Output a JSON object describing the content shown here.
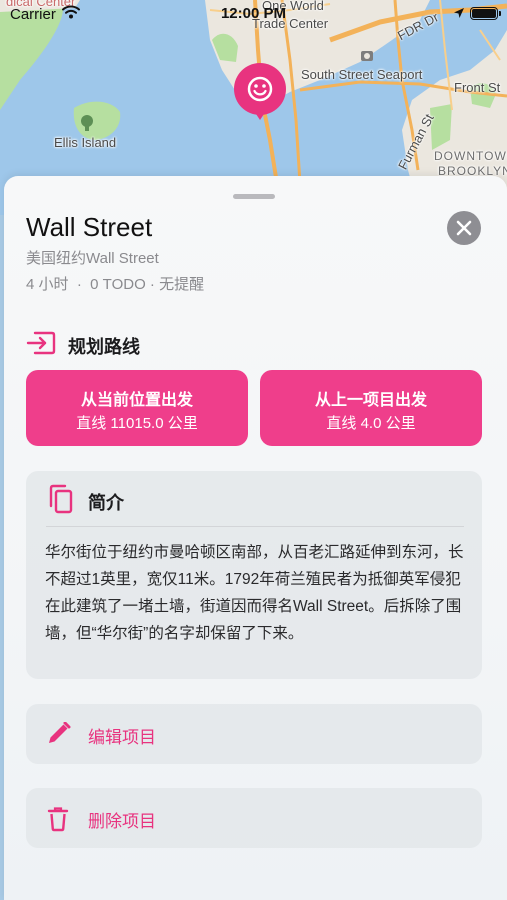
{
  "status_bar": {
    "carrier": "Carrier",
    "time": "12:00 PM"
  },
  "map": {
    "labels": {
      "medical_center": "dical Center",
      "one_world": "One World",
      "trade_center": "Trade Center",
      "fdr_dr": "FDR Dr",
      "south_street_seaport": "South Street Seaport",
      "front_st": "Front St",
      "ellis_island": "Ellis Island",
      "furman_st": "Furman St",
      "downtown": "DOWNTOWN",
      "brooklyn": "BROOKLYN"
    },
    "colors": {
      "water": "#9ec7ea",
      "land": "#ebe7df",
      "park": "#b6dfa0",
      "road": "#f3b259"
    }
  },
  "pin": {
    "icon": "smiley-face-icon",
    "color": "#e8337f"
  },
  "place": {
    "title": "Wall Street",
    "subtitle": "美国纽约Wall Street",
    "meta": "4 小时  ·  0 TODO · 无提醒"
  },
  "route": {
    "title": "规划路线",
    "from_current": {
      "label": "从当前位置出发",
      "distance": "直线 11015.0 公里"
    },
    "from_previous": {
      "label": "从上一项目出发",
      "distance": "直线 4.0 公里"
    }
  },
  "intro": {
    "title": "简介",
    "text": "华尔街位于纽约市曼哈顿区南部，从百老汇路延伸到东河，长不超过1英里，宽仅11米。1792年荷兰殖民者为抵御英军侵犯在此建筑了一堵土墙，街道因而得名Wall Street。后拆除了围墙，但“华尔街”的名字却保留了下来。"
  },
  "actions": {
    "edit_label": "编辑项目",
    "delete_label": "删除项目"
  },
  "accent_color": "#ef3e8b"
}
